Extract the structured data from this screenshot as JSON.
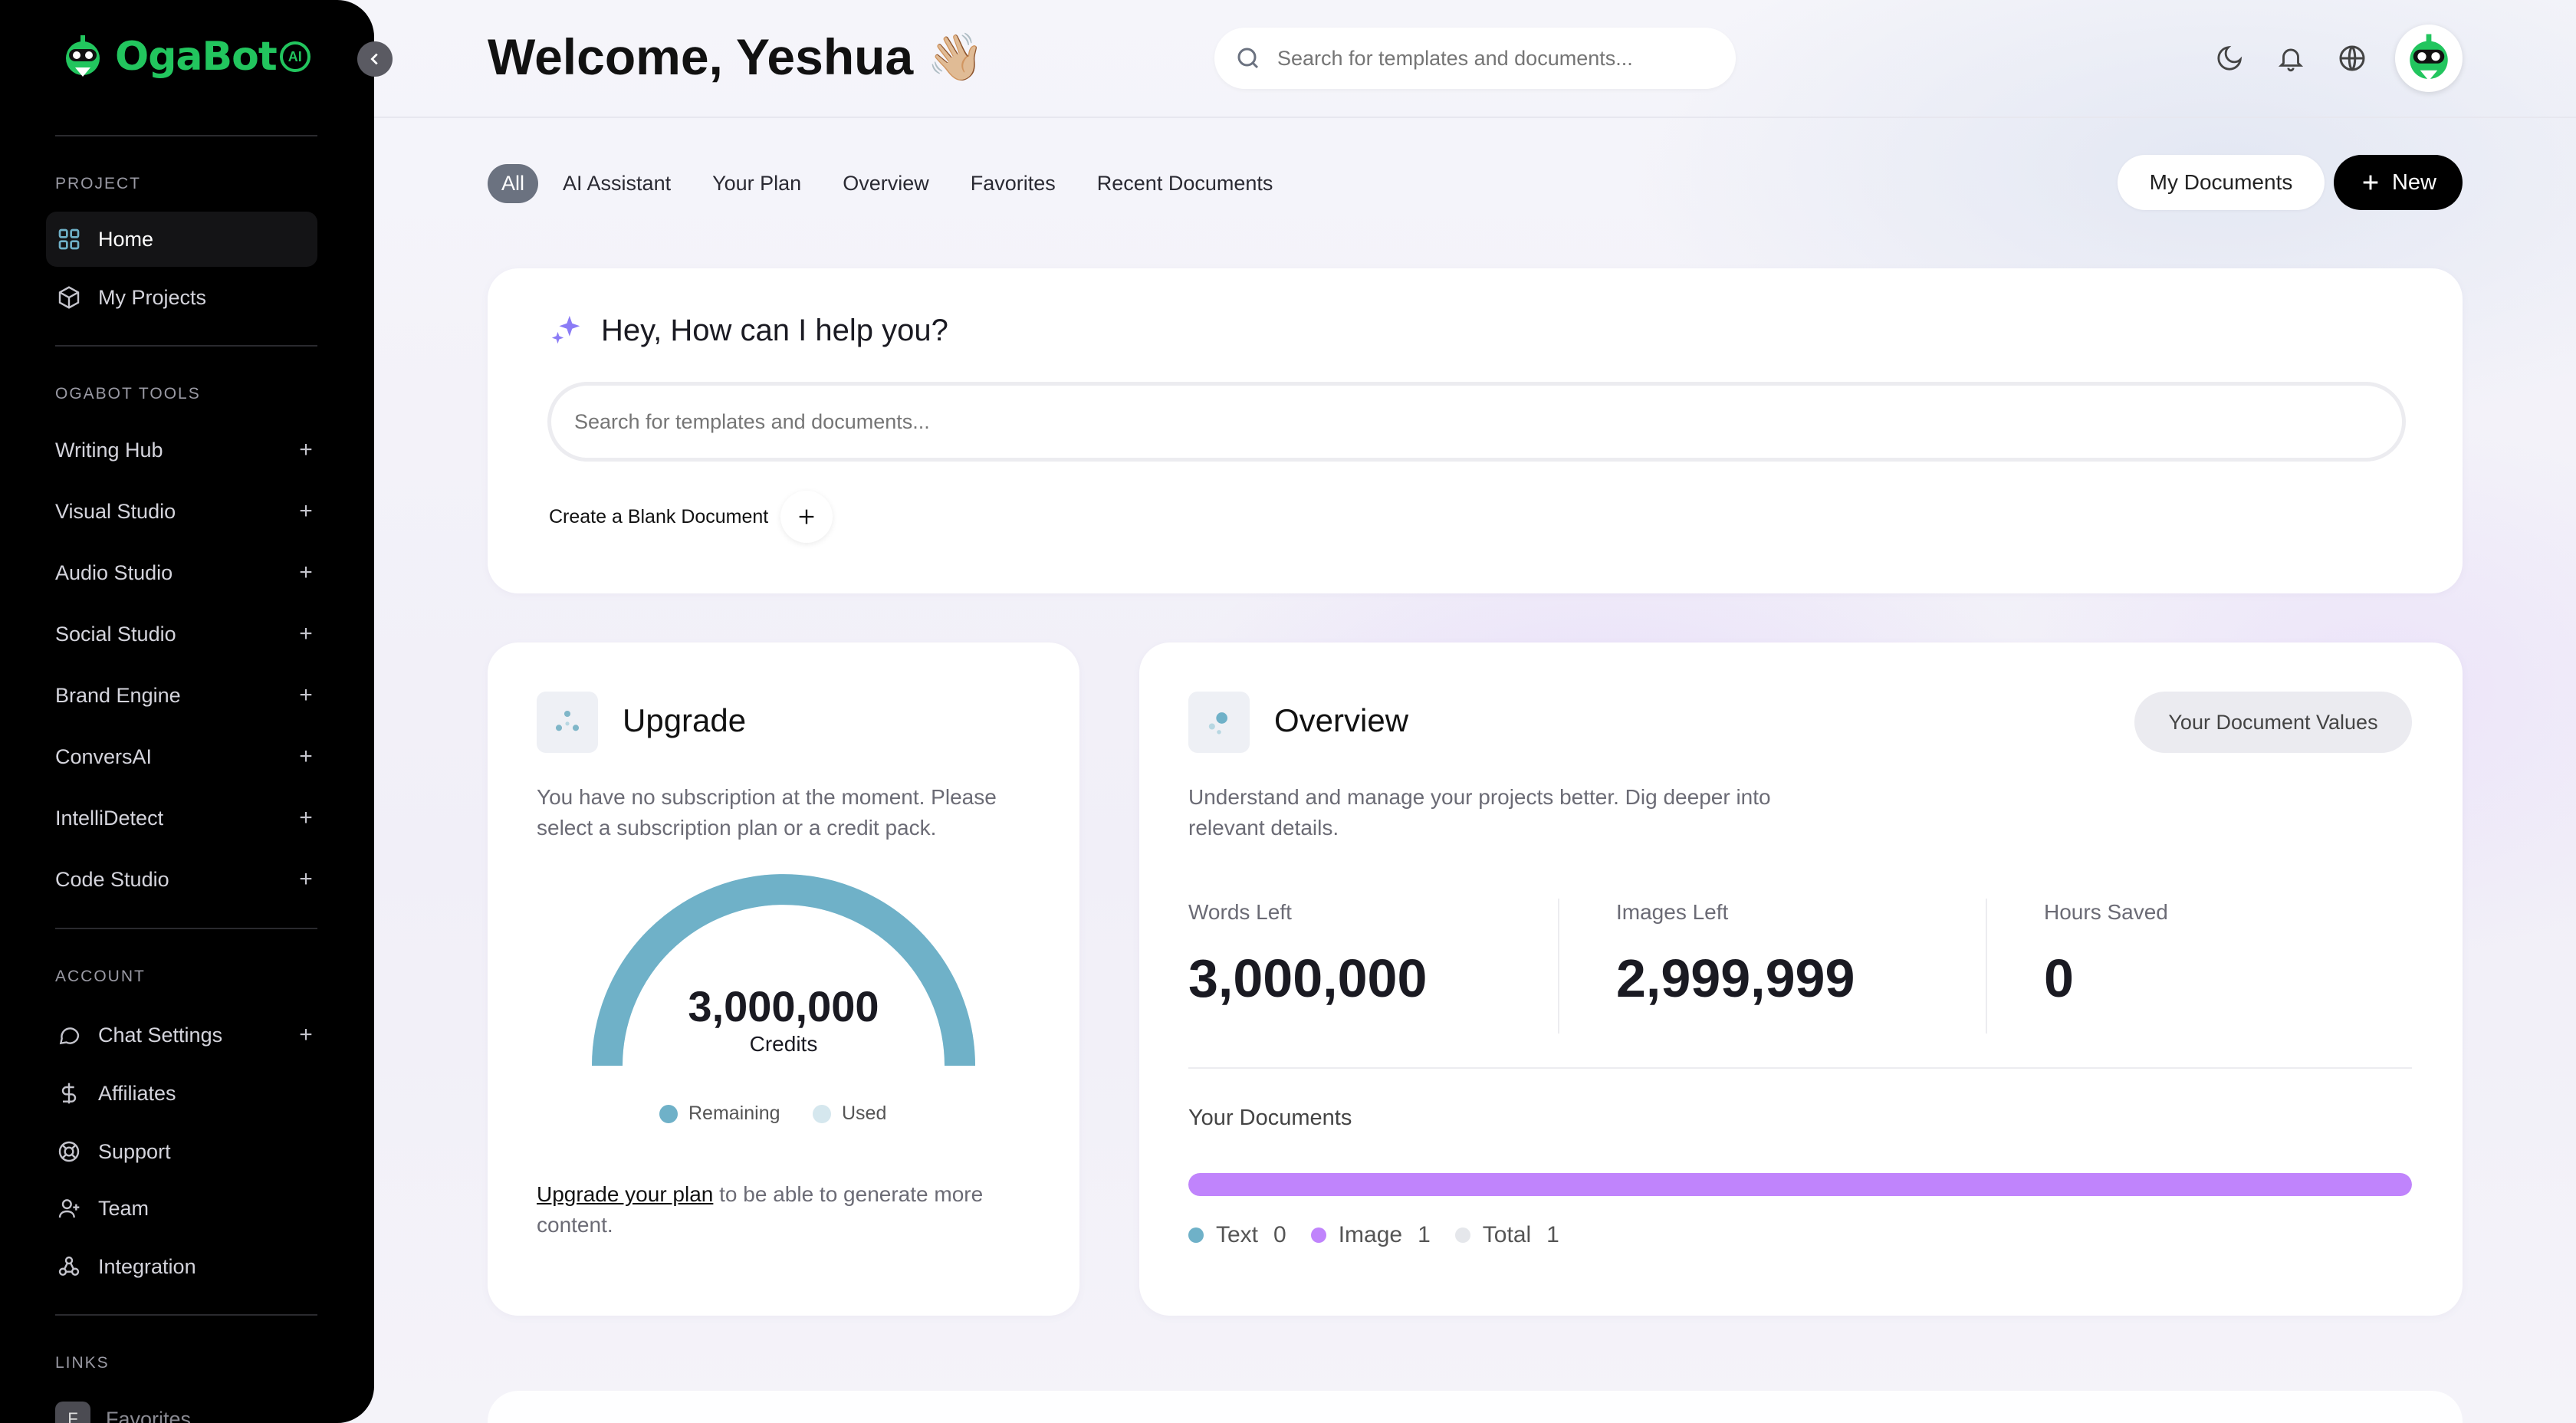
{
  "header": {
    "welcome": "Welcome, Yeshua",
    "wave_emoji": "👋🏼",
    "search_placeholder": "Search for templates and documents..."
  },
  "sidebar": {
    "logo": "OgaBot",
    "logo_badge": "AI",
    "sections": {
      "project": "PROJECT",
      "tools": "OGABOT TOOLS",
      "account": "ACCOUNT",
      "links": "LINKS"
    },
    "project_items": [
      {
        "label": "Home",
        "icon": "grid-icon",
        "active": true
      },
      {
        "label": "My Projects",
        "icon": "cube-icon",
        "active": false
      }
    ],
    "tools": [
      {
        "label": "Writing Hub"
      },
      {
        "label": "Visual Studio"
      },
      {
        "label": "Audio Studio"
      },
      {
        "label": "Social Studio"
      },
      {
        "label": "Brand Engine"
      },
      {
        "label": "ConversAI"
      },
      {
        "label": "IntelliDetect"
      },
      {
        "label": "Code Studio"
      }
    ],
    "account_items": [
      {
        "label": "Chat Settings",
        "icon": "chat-bubble-icon",
        "expandable": true
      },
      {
        "label": "Affiliates",
        "icon": "dollar-icon"
      },
      {
        "label": "Support",
        "icon": "lifebuoy-icon"
      },
      {
        "label": "Team",
        "icon": "user-plus-icon"
      },
      {
        "label": "Integration",
        "icon": "webhook-icon"
      }
    ],
    "links": [
      {
        "label": "Favorites",
        "badge": "F"
      }
    ]
  },
  "tabs": [
    {
      "label": "All",
      "active": true
    },
    {
      "label": "AI Assistant"
    },
    {
      "label": "Your Plan"
    },
    {
      "label": "Overview"
    },
    {
      "label": "Favorites"
    },
    {
      "label": "Recent Documents"
    }
  ],
  "actions": {
    "my_documents": "My Documents",
    "new": "New"
  },
  "help": {
    "title": "Hey, How can I help you?",
    "placeholder": "Search for templates and documents...",
    "blank_doc": "Create a Blank Document"
  },
  "upgrade": {
    "title": "Upgrade",
    "description": "You have no subscription at the moment. Please select a subscription plan or a credit pack.",
    "credits_value": "3,000,000",
    "credits_label": "Credits",
    "remaining_fraction": 1.0,
    "legend_remaining": "Remaining",
    "legend_used": "Used",
    "note_link": "Upgrade your plan",
    "note_rest": " to be able to generate more content."
  },
  "overview": {
    "title": "Overview",
    "button": "Your Document Values",
    "description": "Understand and manage your projects better. Dig deeper into relevant details.",
    "stats": [
      {
        "label": "Words Left",
        "value": "3,000,000"
      },
      {
        "label": "Images Left",
        "value": "2,999,999"
      },
      {
        "label": "Hours Saved",
        "value": "0"
      }
    ],
    "documents_label": "Your Documents",
    "image_fraction": 1.0,
    "legend": [
      {
        "label": "Text",
        "count": "0",
        "color": "#6fb1c8"
      },
      {
        "label": "Image",
        "count": "1",
        "color": "#c084fc"
      },
      {
        "label": "Total",
        "count": "1",
        "color": "#e5e7eb"
      }
    ]
  },
  "colors": {
    "brand_green": "#22c55e",
    "gauge_teal": "#6fb1c8",
    "image_purple": "#c084fc"
  }
}
